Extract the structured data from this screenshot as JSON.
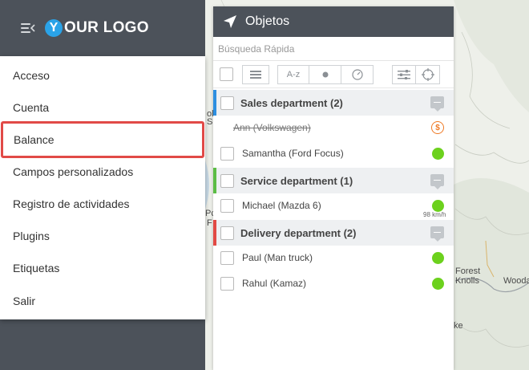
{
  "logo": {
    "letter": "Y",
    "text": "OUR LOGO"
  },
  "menu": {
    "items": [
      {
        "label": "Acceso",
        "selected": false
      },
      {
        "label": "Cuenta",
        "selected": false
      },
      {
        "label": "Balance",
        "selected": true
      },
      {
        "label": "Campos personalizados",
        "selected": false
      },
      {
        "label": "Registro de actividades",
        "selected": false
      },
      {
        "label": "Plugins",
        "selected": false
      },
      {
        "label": "Etiquetas",
        "selected": false
      },
      {
        "label": "Salir",
        "selected": false
      }
    ]
  },
  "panel": {
    "title": "Objetos",
    "search_placeholder": "Búsqueda Rápida",
    "toolbar": {
      "sort_label": "A-z"
    }
  },
  "groups": [
    {
      "name": "Sales department (2)",
      "color": "#2d8fe0",
      "objects": [
        {
          "name": "Ann (Volkswagen)",
          "strike": true,
          "status": "money-icon",
          "status_color": "#ef7a25"
        },
        {
          "name": "Samantha (Ford Focus)",
          "strike": false,
          "status": "online-dot",
          "status_color": "#6cd11d"
        }
      ]
    },
    {
      "name": "Service department (1)",
      "color": "#5cbd45",
      "objects": [
        {
          "name": "Michael (Mazda 6)",
          "strike": false,
          "status": "online-dot",
          "status_color": "#6cd11d",
          "speed": "98 km/h"
        }
      ]
    },
    {
      "name": "Delivery department (2)",
      "color": "#e24a44",
      "objects": [
        {
          "name": "Paul (Man truck)",
          "strike": false,
          "status": "online-dot",
          "status_color": "#6cd11d"
        },
        {
          "name": "Rahul (Kamaz)",
          "strike": false,
          "status": "online-dot",
          "status_color": "#6cd11d"
        }
      ]
    }
  ],
  "map": {
    "labels": {
      "forest_knolls_line1": "Forest",
      "forest_knolls_line2": "Knolls",
      "woodacre": "Wooda",
      "l1": "ol",
      "l2": "S",
      "l3": "Pc",
      "l4": "F",
      "l5": "ke"
    }
  },
  "colors": {
    "accent": "#2aa3e8",
    "sidebar": "#4c525a",
    "selected_border": "#e14a47"
  }
}
